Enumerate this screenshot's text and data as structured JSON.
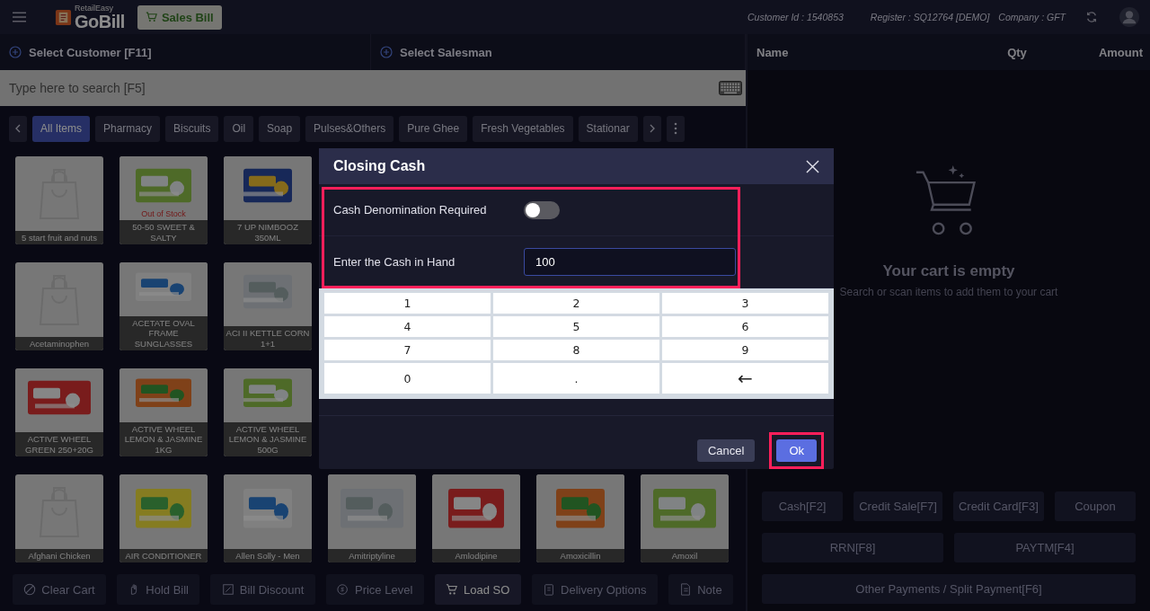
{
  "top_bar": {
    "app_small": "RetailEasy",
    "app_name": "GoBill",
    "mode_button": "Sales Bill",
    "customer_id": "Customer Id : 1540853",
    "register": "Register : SQ12764 [DEMO]",
    "company": "Company : GFT"
  },
  "customer_bar": {
    "customer": "Select Customer [F11]",
    "salesman": "Select Salesman"
  },
  "search": {
    "placeholder": "Type here to search [F5]"
  },
  "categories": [
    {
      "label": "All Items",
      "selected": true
    },
    {
      "label": "Pharmacy",
      "selected": false
    },
    {
      "label": "Biscuits",
      "selected": false
    },
    {
      "label": "Oil",
      "selected": false
    },
    {
      "label": "Soap",
      "selected": false
    },
    {
      "label": "Pulses&Others",
      "selected": false
    },
    {
      "label": "Pure Ghee",
      "selected": false
    },
    {
      "label": "Fresh Vegetables",
      "selected": false
    },
    {
      "label": "Stationar",
      "selected": false
    }
  ],
  "product_rows": [
    [
      {
        "name": "5 start fruit and nuts",
        "kind": "placeholder"
      },
      {
        "name": "50-50 SWEET & SALTY",
        "kind": "picture",
        "badge": "Out of Stock"
      },
      {
        "name": "7 UP NIMBOOZ 350ML",
        "kind": "picture"
      }
    ],
    [
      {
        "name": "Acetaminophen",
        "kind": "placeholder"
      },
      {
        "name": "ACETATE OVAL FRAME SUNGLASSES",
        "kind": "picture"
      },
      {
        "name": "ACI II KETTLE CORN 1+1",
        "kind": "picture"
      }
    ],
    [
      {
        "name": "ACTIVE WHEEL GREEN 250+20G",
        "kind": "picture"
      },
      {
        "name": "ACTIVE WHEEL LEMON & JASMINE 1KG",
        "kind": "picture"
      },
      {
        "name": "ACTIVE WHEEL LEMON & JASMINE 500G",
        "kind": "picture"
      }
    ],
    [
      {
        "name": "Afghani Chicken",
        "kind": "placeholder"
      },
      {
        "name": "AIR CONDITIONER",
        "kind": "picture"
      },
      {
        "name": "Allen Solly - Men",
        "kind": "picture"
      },
      {
        "name": "Amitriptyline",
        "kind": "picture"
      },
      {
        "name": "Amlodipine",
        "kind": "picture"
      },
      {
        "name": "Amoxicillin",
        "kind": "picture"
      },
      {
        "name": "Amoxil",
        "kind": "picture"
      }
    ]
  ],
  "actions": [
    {
      "label": "Clear Cart",
      "disabled": true
    },
    {
      "label": "Hold Bill",
      "disabled": true
    },
    {
      "label": "Bill Discount",
      "disabled": true
    },
    {
      "label": "Price Level",
      "disabled": true
    },
    {
      "label": "Load SO",
      "disabled": false
    },
    {
      "label": "Delivery Options",
      "disabled": true
    },
    {
      "label": "Note",
      "disabled": true
    }
  ],
  "cart": {
    "columns": [
      "Name",
      "Qty",
      "Amount"
    ],
    "empty_title": "Your cart is empty",
    "empty_hint": "Search or scan items to add them to your cart"
  },
  "payment_rows": [
    [
      {
        "label": "Cash[F2]",
        "disabled": true
      },
      {
        "label": "Credit Sale[F7]",
        "disabled": true
      },
      {
        "label": "Credit Card[F3]",
        "disabled": true
      },
      {
        "label": "Coupon",
        "disabled": true
      }
    ],
    [
      {
        "label": "RRN[F8]",
        "disabled": true
      },
      {
        "label": "PAYTM[F4]",
        "disabled": true
      }
    ],
    [
      {
        "label": "Other Payments / Split Payment[F6]",
        "disabled": true
      }
    ]
  ],
  "dialog": {
    "title": "Closing Cash",
    "fields_highlighted": true,
    "denomination_label": "Cash Denomination Required",
    "denomination_on": false,
    "cash_label": "Enter the Cash in Hand",
    "cash_value": "100",
    "keypad": [
      "1",
      "2",
      "3",
      "4",
      "5",
      "6",
      "7",
      "8",
      "9",
      "0",
      ".",
      "←"
    ],
    "buttons": [
      {
        "label": "Cancel",
        "kind": "secondary",
        "highlighted": false
      },
      {
        "label": "Ok",
        "kind": "primary",
        "highlighted": true
      }
    ]
  }
}
